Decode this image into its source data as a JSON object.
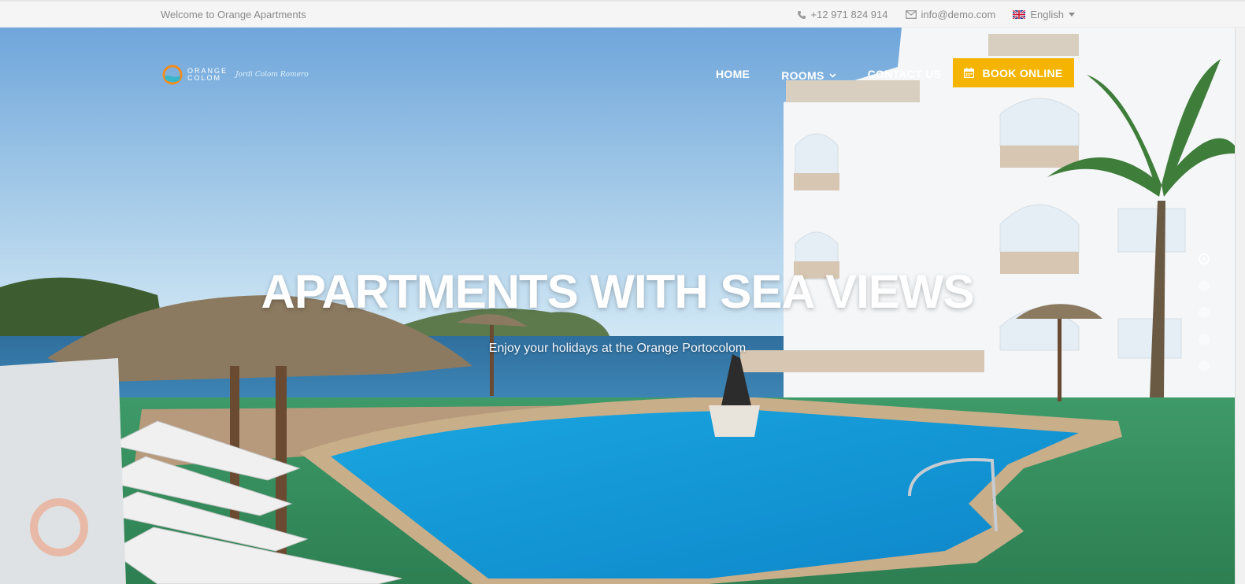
{
  "topbar": {
    "welcome": "Welcome to Orange Apartments",
    "phone": "+12 971 824 914",
    "email": "info@demo.com",
    "language": "English"
  },
  "logo": {
    "line1": "ORANGE",
    "line2": "COLOM",
    "script": "Jordi Colom Romero"
  },
  "nav": {
    "home": "HOME",
    "rooms": "ROOMS",
    "contact": "CONTACT US",
    "book": "BOOK ONLINE"
  },
  "hero": {
    "title": "APARTMENTS WITH SEA VIEWS",
    "subtitle": "Enjoy your holidays at the Orange Portocolom",
    "active_slide": 1,
    "slide_count": 5
  },
  "colors": {
    "accent": "#f4b400",
    "topbar_bg": "#f5f5f5",
    "topbar_text": "#8a8a8a"
  }
}
